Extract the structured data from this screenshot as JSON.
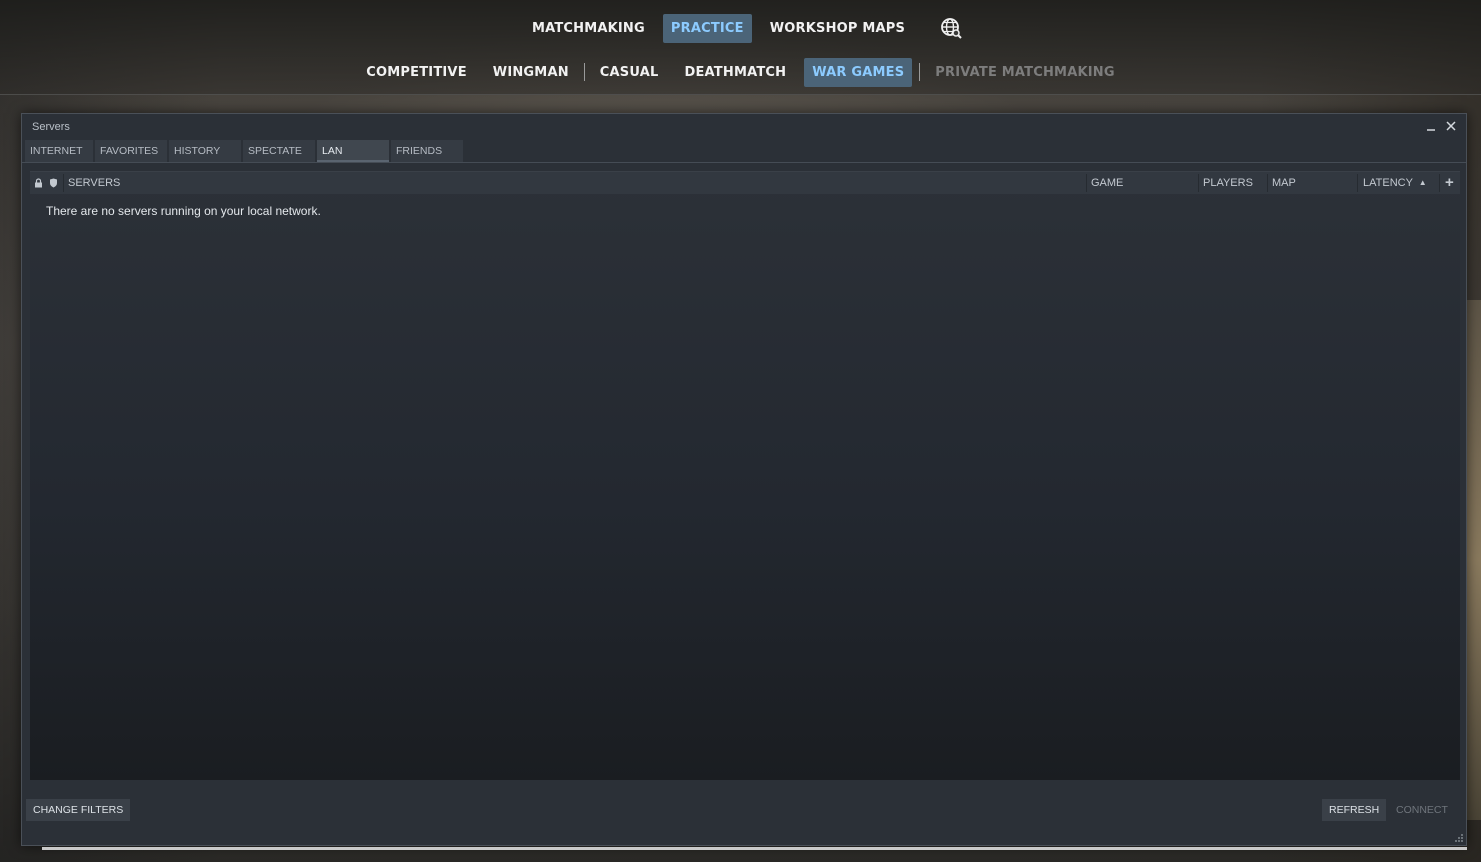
{
  "nav": {
    "primary": [
      "MATCHMAKING",
      "PRACTICE",
      "WORKSHOP MAPS"
    ],
    "primary_active": "PRACTICE",
    "secondary": [
      "COMPETITIVE",
      "WINGMAN",
      "CASUAL",
      "DEATHMATCH",
      "WAR GAMES",
      "PRIVATE MATCHMAKING"
    ],
    "secondary_active": "WAR GAMES",
    "secondary_disabled": "PRIVATE MATCHMAKING",
    "globe_icon": "globe-search-icon"
  },
  "window": {
    "title": "Servers",
    "tabs": [
      "INTERNET",
      "FAVORITES",
      "HISTORY",
      "SPECTATE",
      "LAN",
      "FRIENDS"
    ],
    "active_tab": "LAN",
    "columns": {
      "servers": "SERVERS",
      "game": "GAME",
      "players": "PLAYERS",
      "map": "MAP",
      "latency": "LATENCY",
      "sort_indicator": "▲",
      "add": "+"
    },
    "empty_message": "There are no servers running on your local network.",
    "buttons": {
      "change_filters": "CHANGE FILTERS",
      "refresh": "REFRESH",
      "connect": "CONNECT"
    }
  },
  "colors": {
    "active_text": "#8ccbff",
    "active_bg": "#4b6478",
    "panel_bg": "#2b3037"
  }
}
